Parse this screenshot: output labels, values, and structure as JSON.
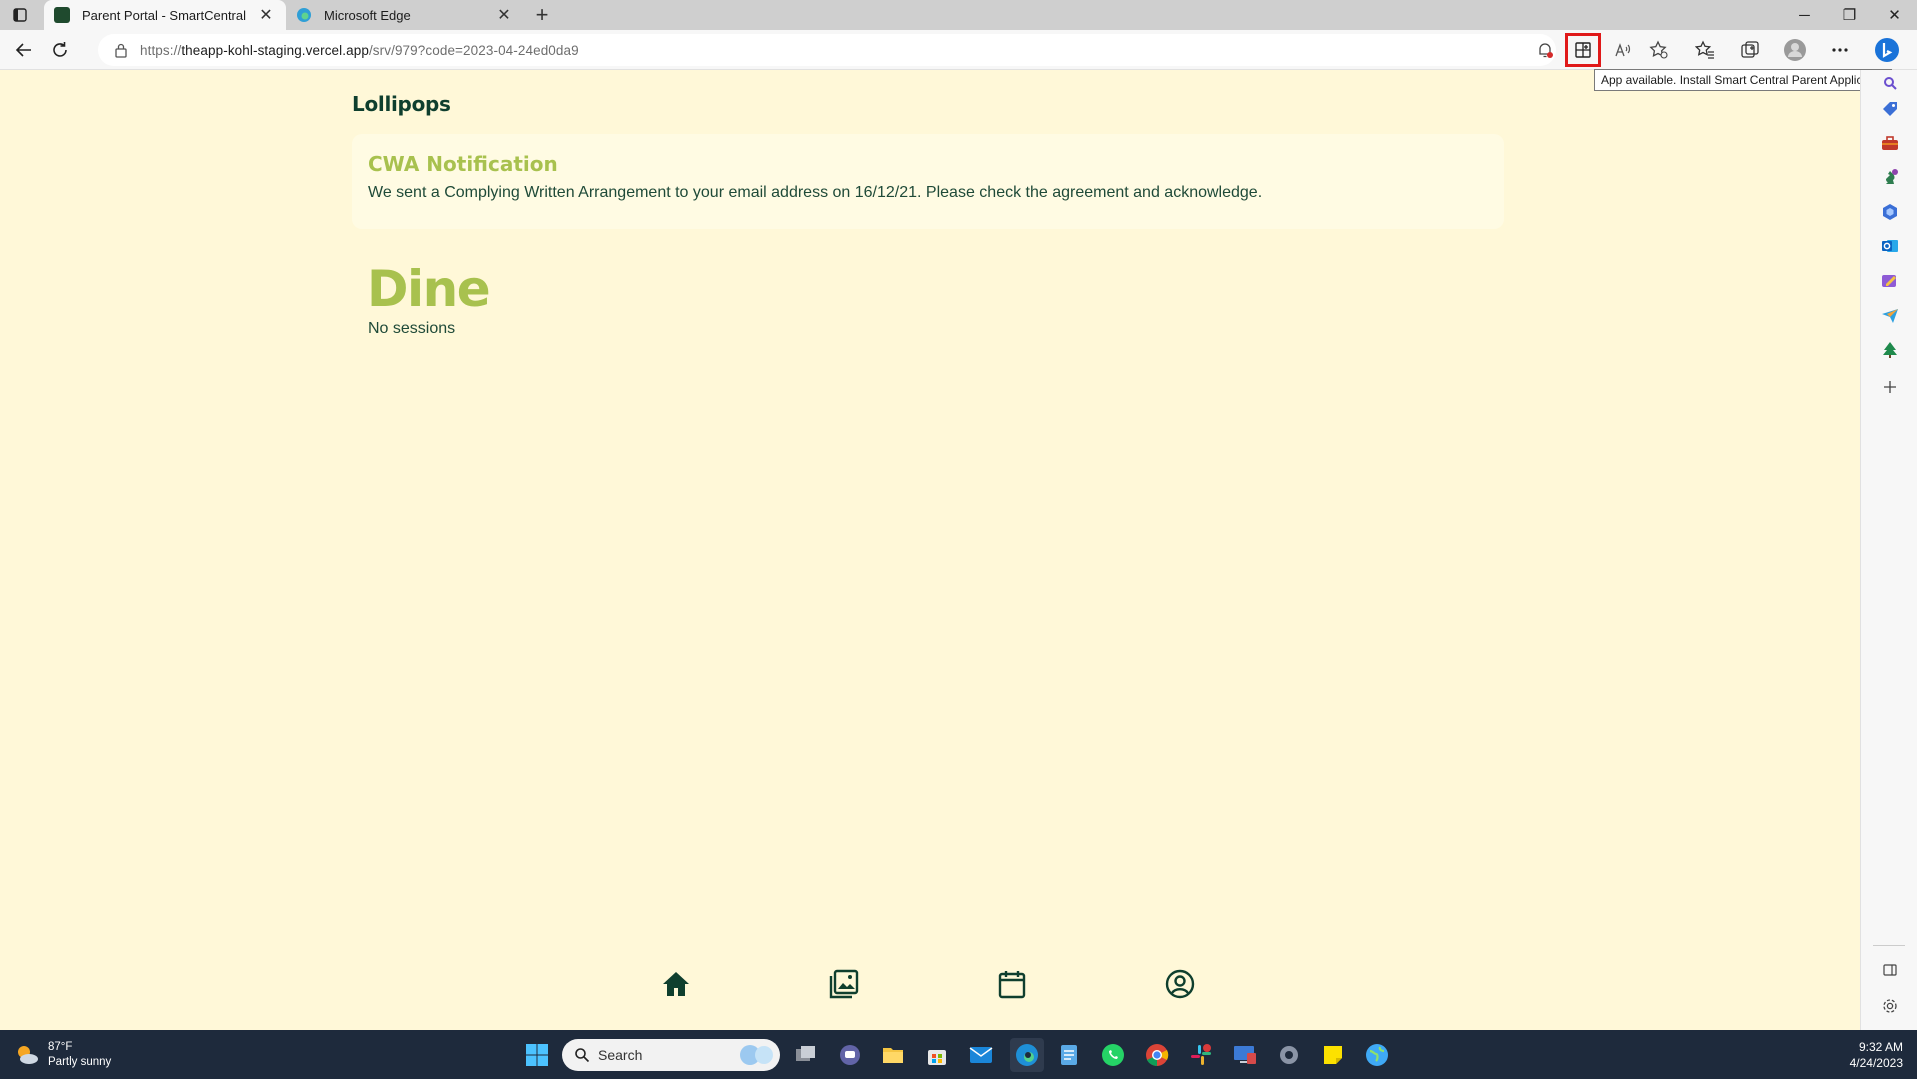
{
  "browser": {
    "tabs": [
      {
        "title": "Parent Portal - SmartCentral",
        "active": true
      },
      {
        "title": "Microsoft Edge",
        "active": false
      }
    ],
    "url_prefix": "https://",
    "url_host": "theapp-kohl-staging.vercel.app",
    "url_path": "/srv/979?code=2023-04-24ed0da9",
    "tooltip": "App available. Install Smart Central Parent Application"
  },
  "page": {
    "site_title": "Lollipops",
    "notification": {
      "title": "CWA Notification",
      "text": "We sent a Complying Written Arrangement to your email address on 16/12/21. Please check the agreement and acknowledge."
    },
    "section": {
      "title": "Dine",
      "subtitle": "No sessions"
    },
    "bottom_nav": [
      "home-icon",
      "gallery-icon",
      "calendar-icon",
      "profile-icon"
    ]
  },
  "taskbar": {
    "weather_temp": "87°F",
    "weather_desc": "Partly sunny",
    "search_label": "Search",
    "time": "9:32 AM",
    "date": "4/24/2023"
  },
  "colors": {
    "page_bg": "#fff8d8",
    "brand_dark": "#0f3f2e",
    "brand_green": "#a8c14e",
    "highlight": "#e01919"
  }
}
